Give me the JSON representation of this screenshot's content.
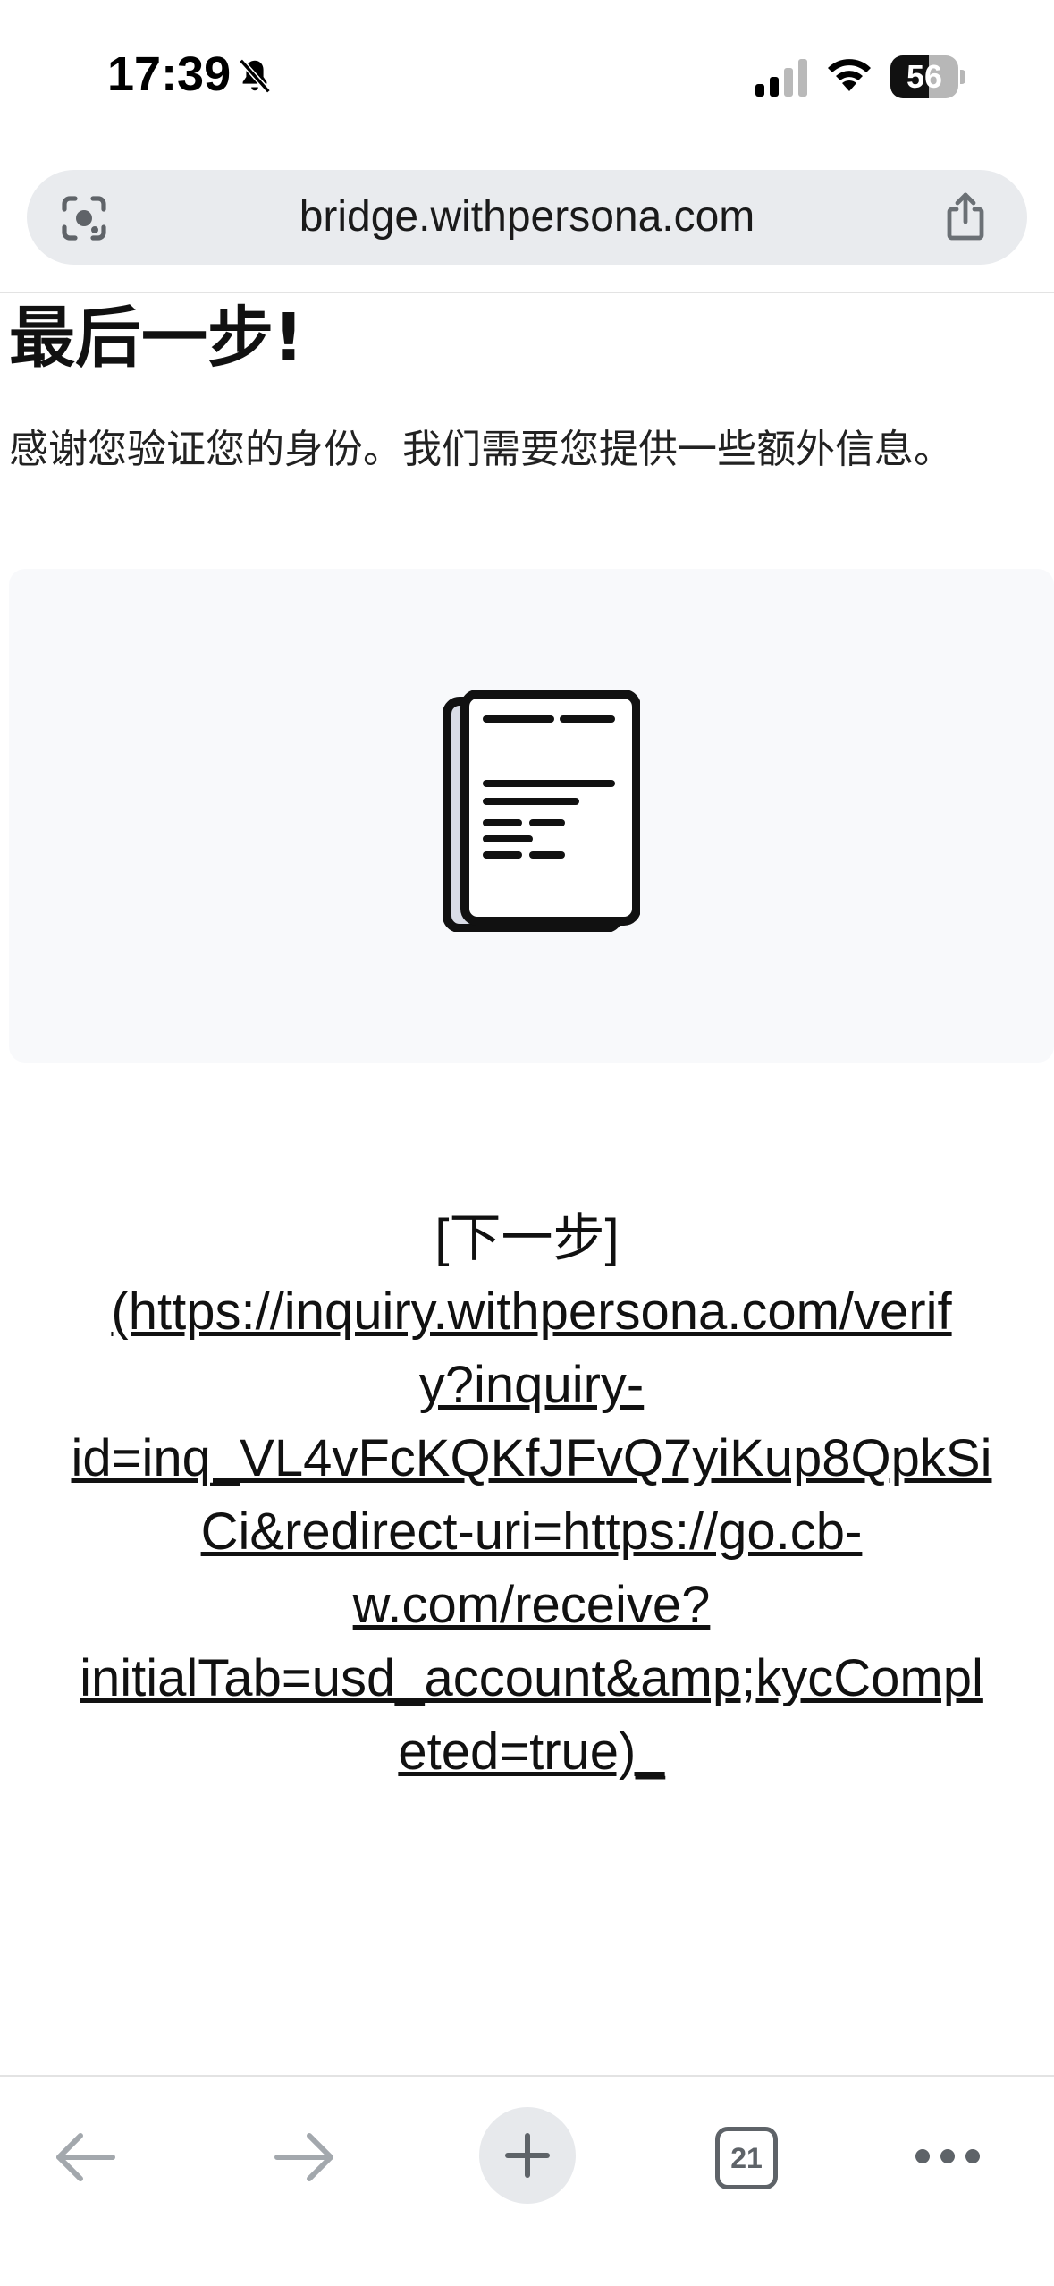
{
  "status_bar": {
    "time": "17:39",
    "battery_percent": "56",
    "battery_level": 0.56,
    "icons": [
      "bell-slash-icon",
      "signal-icon",
      "wifi-icon",
      "battery-icon"
    ]
  },
  "address_bar": {
    "url": "bridge.withpersona.com",
    "icons": [
      "camera-lens-icon",
      "share-icon"
    ]
  },
  "content": {
    "heading": "最后一步!",
    "subtitle": "感谢您验证您的身份。我们需要您提供一些额外信息。",
    "card_icon": "document-icon",
    "next_step_label": "[下一步]",
    "next_step_link": "(https://inquiry.withpersona.com/verif\ny?inquiry-\nid=inq_VL4vFcKQKfJFvQ7yiKup8QpkSi\nCi&redirect-uri=https://go.cb-\nw.com/receive?\ninitialTab=usd_account&amp;kycCompl\neted=true)_"
  },
  "toolbar": {
    "open_tabs_count": "21",
    "icons": [
      "back-arrow-icon",
      "forward-arrow-icon",
      "plus-icon",
      "tabs-icon",
      "more-icon"
    ]
  },
  "colors": {
    "address_bar_bg": "#e9ebee",
    "card_bg": "#f8f9fb",
    "toolbar_icon": "#9aa0a6"
  }
}
